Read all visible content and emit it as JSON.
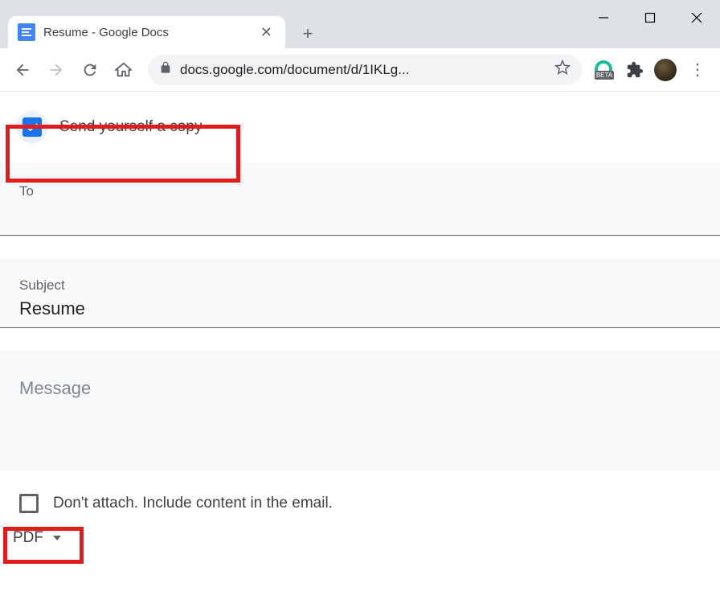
{
  "window": {
    "tab_title": "Resume - Google Docs",
    "url": "docs.google.com/document/d/1IKLg...",
    "beta_label": "BETA"
  },
  "dialog": {
    "send_copy_label": "Send yourself a copy",
    "send_copy_checked": true,
    "to_label": "To",
    "to_value": "",
    "subject_label": "Subject",
    "subject_value": "Resume",
    "message_label": "Message",
    "dont_attach_label": "Don't attach. Include content in the email.",
    "dont_attach_checked": false,
    "format_label": "PDF"
  }
}
